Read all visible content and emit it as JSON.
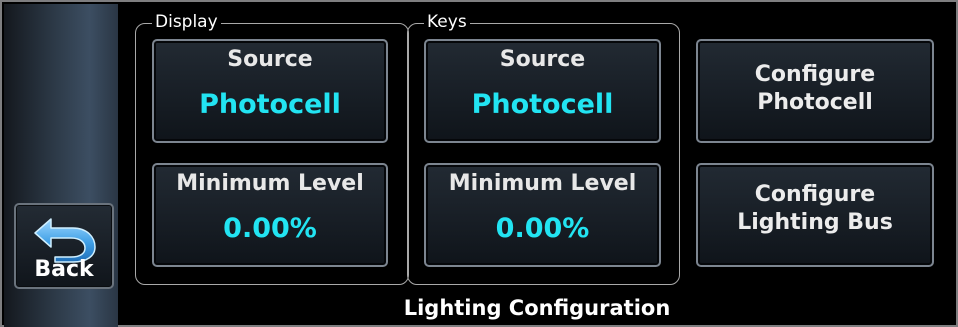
{
  "back": {
    "label": "Back",
    "icon": "back-arrow-icon"
  },
  "display_group": {
    "title": "Display",
    "source": {
      "caption": "Source",
      "value": "Photocell"
    },
    "minimum_level": {
      "caption": "Minimum Level",
      "value": "0.00%"
    }
  },
  "keys_group": {
    "title": "Keys",
    "source": {
      "caption": "Source",
      "value": "Photocell"
    },
    "minimum_level": {
      "caption": "Minimum Level",
      "value": "0.00%"
    }
  },
  "actions": {
    "configure_photocell": {
      "line1": "Configure",
      "line2": "Photocell"
    },
    "configure_lighting_bus": {
      "line1": "Configure",
      "line2": "Lighting Bus"
    }
  },
  "page_title": "Lighting Configuration",
  "colors": {
    "value_cyan": "#22e4f2",
    "background": "#000000",
    "button_border": "#7c8590"
  }
}
